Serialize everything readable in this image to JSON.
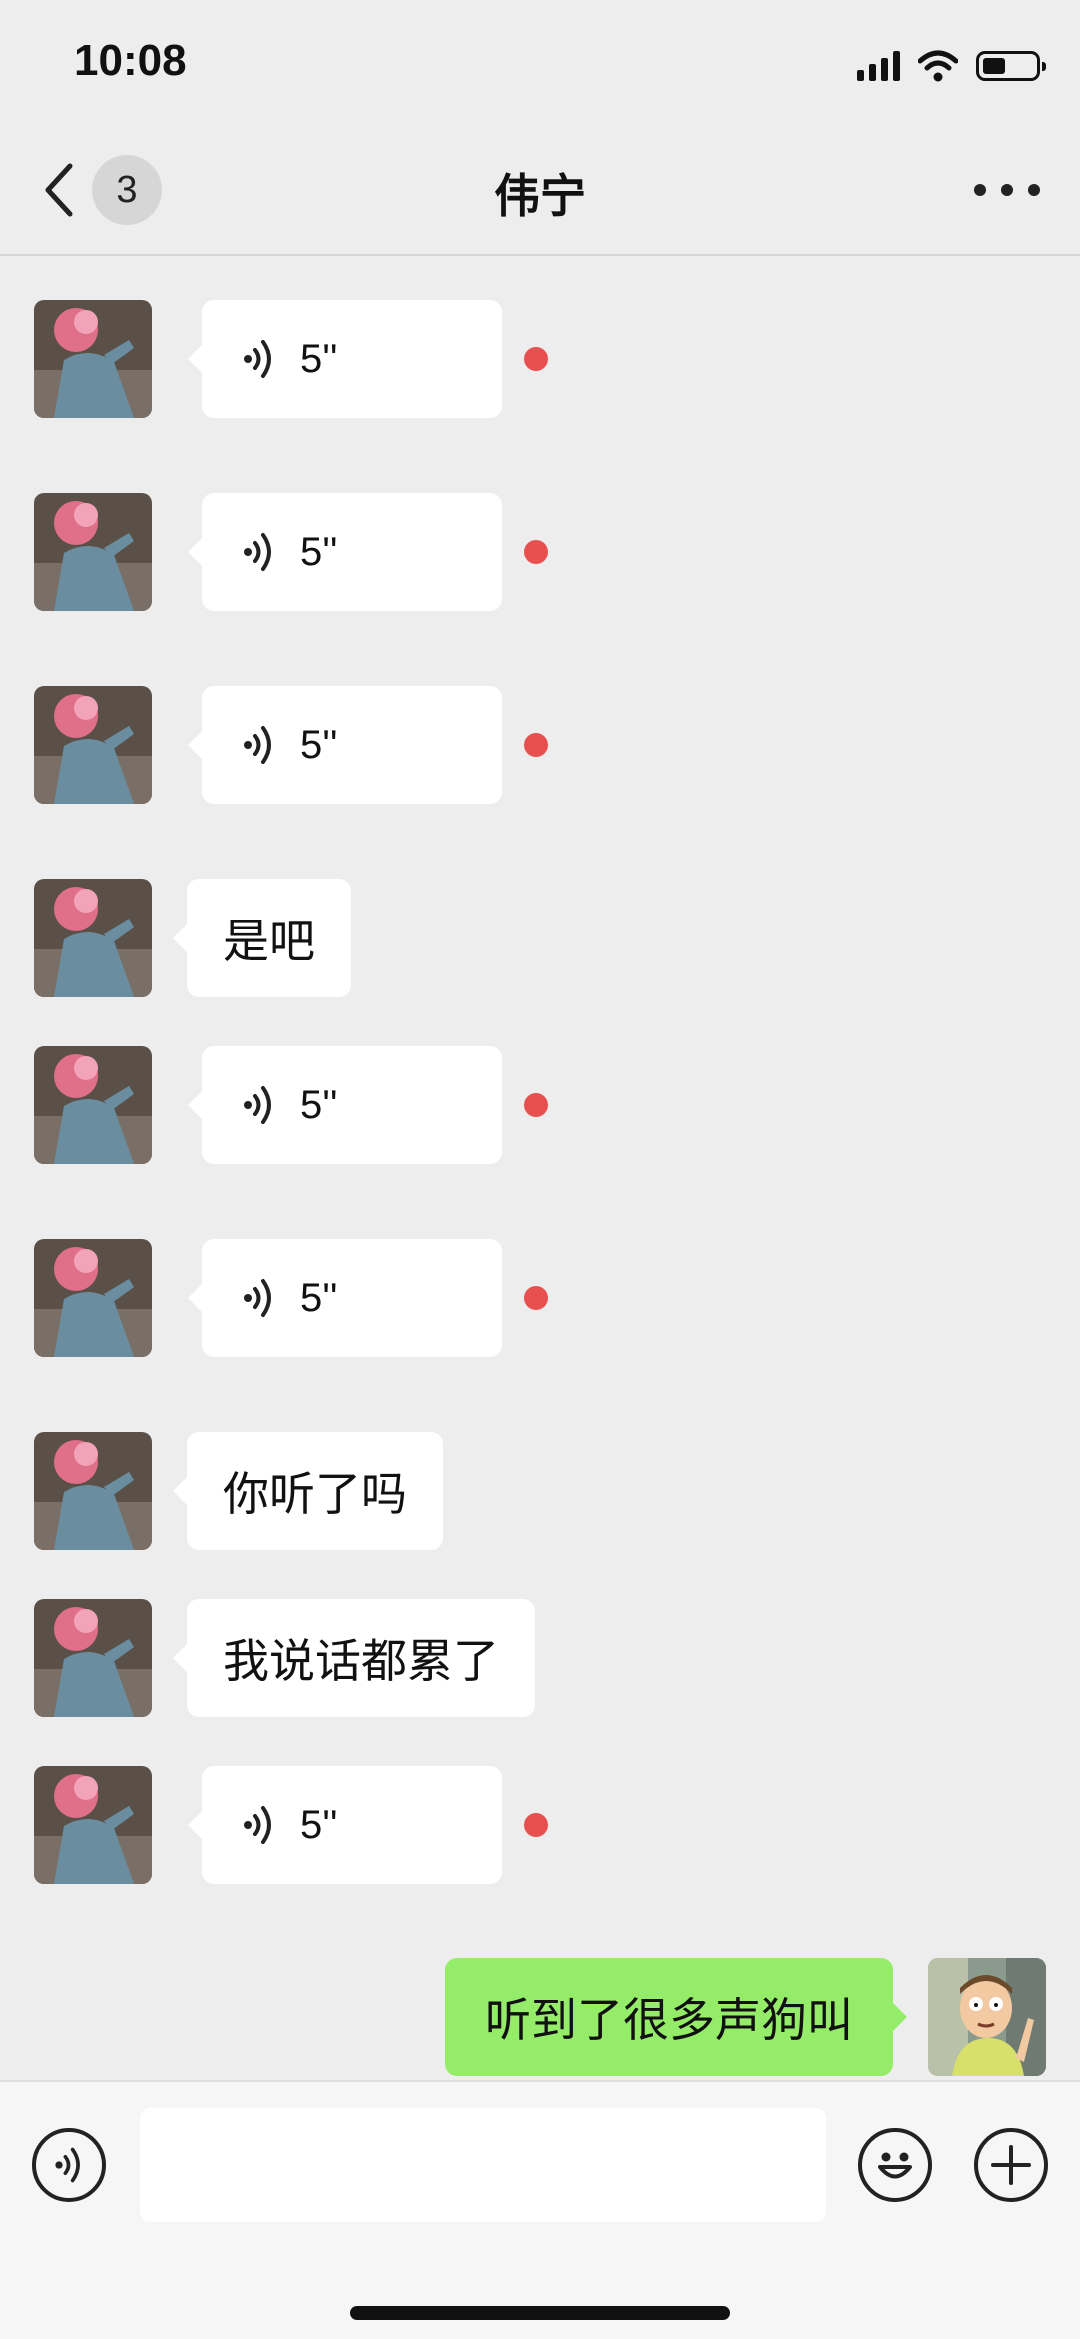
{
  "status_bar": {
    "time": "10:08",
    "battery_level": 0.4
  },
  "nav": {
    "unread_count": "3",
    "title": "伟宁",
    "back_icon": "chevron-left-icon",
    "more_icon": "ellipsis-icon"
  },
  "messages": [
    {
      "type": "voice",
      "duration": "5''",
      "unread": true
    },
    {
      "type": "voice",
      "duration": "5''",
      "unread": true
    },
    {
      "type": "voice",
      "duration": "5''",
      "unread": true
    },
    {
      "type": "text",
      "text": "是吧"
    },
    {
      "type": "voice",
      "duration": "5''",
      "unread": true
    },
    {
      "type": "voice",
      "duration": "5''",
      "unread": true
    },
    {
      "type": "text",
      "text": "你听了吗"
    },
    {
      "type": "text",
      "text": "我说话都累了"
    },
    {
      "type": "voice",
      "duration": "5''",
      "unread": true
    },
    {
      "type": "text",
      "text": "听到了很多声狗叫",
      "sender": "me"
    }
  ],
  "input_bar": {
    "voice_icon": "voice-mode-icon",
    "emoji_icon": "emoji-icon",
    "plus_icon": "plus-icon",
    "message_value": ""
  },
  "colors": {
    "background": "#ededed",
    "my_bubble": "#95ec69",
    "their_bubble": "#ffffff",
    "unread_dot": "#e8504f"
  }
}
